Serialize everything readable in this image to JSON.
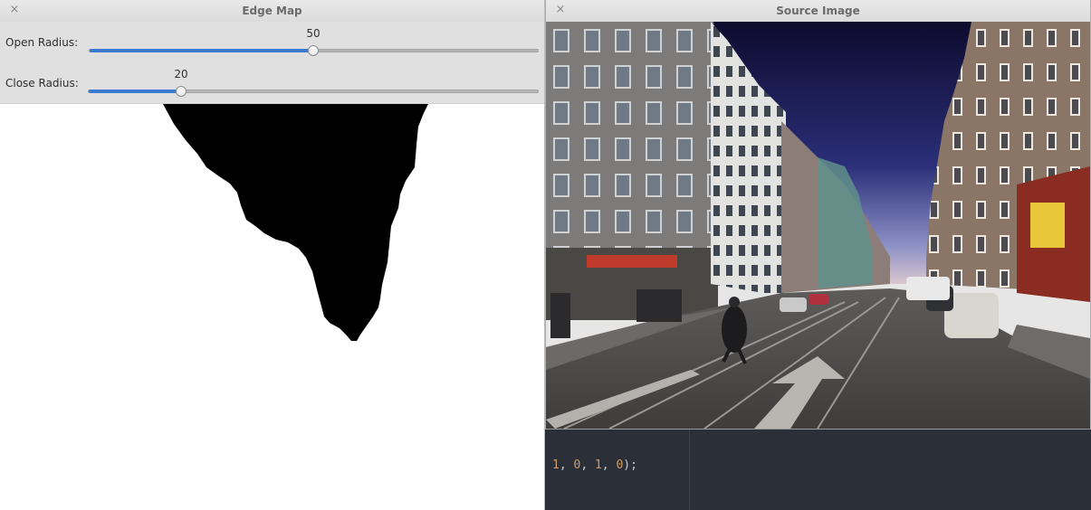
{
  "edge_window": {
    "title": "Edge Map",
    "close_glyph": "×",
    "open_radius": {
      "label": "Open Radius:",
      "value": "50",
      "min": 0,
      "max": 100,
      "fraction": 0.5
    },
    "close_radius": {
      "label": "Close Radius:",
      "value": "20",
      "min": 0,
      "max": 100,
      "fraction": 0.2
    }
  },
  "source_window": {
    "title": "Source Image",
    "close_glyph": "×"
  },
  "editor": {
    "n1": "1",
    "sep1": ", ",
    "n2": "0",
    "sep2": ", ",
    "n3": "1",
    "sep3": ", ",
    "n4": "0",
    "tail": ");"
  },
  "colors": {
    "accent": "#3a7bd0",
    "editor_bg": "#2b2f38",
    "number": "#d19a66"
  },
  "icons": {
    "close": "close-icon"
  }
}
